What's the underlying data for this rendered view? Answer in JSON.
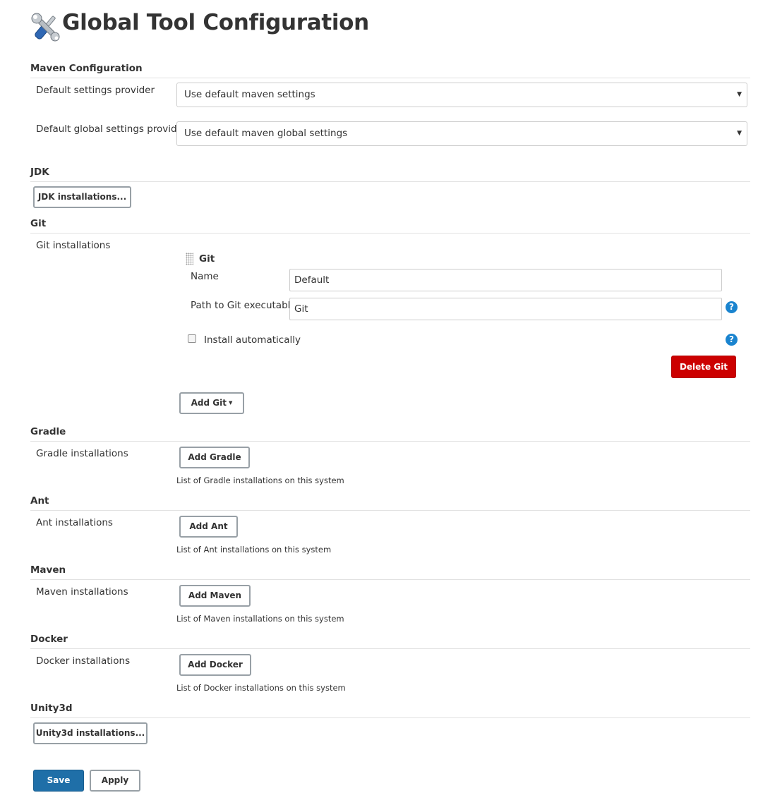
{
  "page": {
    "title": "Global Tool Configuration"
  },
  "maven_configuration": {
    "heading": "Maven Configuration",
    "settings_label": "Default settings provider",
    "settings_value": "Use default maven settings",
    "global_settings_label": "Default global settings provider",
    "global_settings_value": "Use default maven global settings"
  },
  "jdk": {
    "heading": "JDK",
    "button": "JDK installations..."
  },
  "git": {
    "heading": "Git",
    "installations_label": "Git installations",
    "block_title": "Git",
    "name_label": "Name",
    "name_value": "Default",
    "path_label": "Path to Git executable",
    "path_value": "Git",
    "install_auto_label": "Install automatically",
    "install_auto_checked": false,
    "delete_button": "Delete Git",
    "add_button": "Add Git"
  },
  "gradle": {
    "heading": "Gradle",
    "installations_label": "Gradle installations",
    "add_button": "Add Gradle",
    "description": "List of Gradle installations on this system"
  },
  "ant": {
    "heading": "Ant",
    "installations_label": "Ant installations",
    "add_button": "Add Ant",
    "description": "List of Ant installations on this system"
  },
  "maven": {
    "heading": "Maven",
    "installations_label": "Maven installations",
    "add_button": "Add Maven",
    "description": "List of Maven installations on this system"
  },
  "docker": {
    "heading": "Docker",
    "installations_label": "Docker installations",
    "add_button": "Add Docker",
    "description": "List of Docker installations on this system"
  },
  "unity3d": {
    "heading": "Unity3d",
    "button": "Unity3d installations..."
  },
  "footer": {
    "save_button": "Save",
    "apply_button": "Apply"
  },
  "icons": {
    "help": "?",
    "dropdown_caret": "▼"
  },
  "colors": {
    "delete": "#cc0000",
    "save": "#1f6fa8",
    "help": "#1a84cf"
  }
}
